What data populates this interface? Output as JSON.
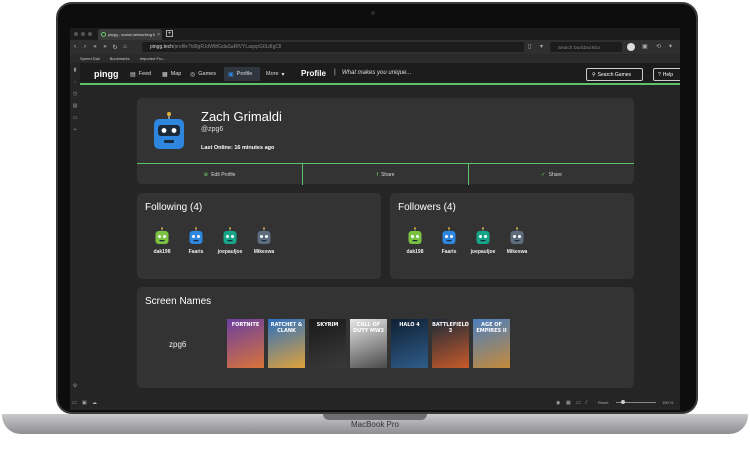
{
  "device": {
    "label": "MacBook Pro"
  },
  "browser": {
    "tab_title": "pingg - social networking fo",
    "tab_close": "×",
    "new_tab": "+",
    "url_host": "pingg.tech",
    "url_path": "/profile?id9gRJdWMGdaSaRfVYLaqxpG0LdIgCll",
    "search_placeholder": "Search DuckDuckGo",
    "bookmarks": [
      "Speed Dial",
      "Bookmarks",
      "Imported Fro..."
    ],
    "status_reset": "Reset",
    "zoom": "100 %"
  },
  "site": {
    "logo": "pingg",
    "nav": [
      {
        "label": "Feed",
        "icon": "feed-icon"
      },
      {
        "label": "Map",
        "icon": "map-icon"
      },
      {
        "label": "Games",
        "icon": "gamepad-icon"
      },
      {
        "label": "Profile",
        "icon": "robot-icon",
        "active": true
      },
      {
        "label": "More",
        "icon": "chevron-down-icon"
      }
    ],
    "page_title": "Profile",
    "separator": "|",
    "tagline": "What makes you unique...",
    "search_games": "Search Games",
    "help": "Help"
  },
  "profile": {
    "name": "Zach Grimaldi",
    "handle": "@zpg6",
    "last_online_label": "Last Online:",
    "last_online_value": "16 minutes ago",
    "actions": [
      "Edit Profile",
      "Share",
      "Share"
    ]
  },
  "following": {
    "title": "Following (4)",
    "users": [
      {
        "name": "dak198",
        "color": "#7ac143"
      },
      {
        "name": "Faaris",
        "color": "#2e86de"
      },
      {
        "name": "joepauljoe",
        "color": "#17a589"
      },
      {
        "name": "Mikeswa",
        "color": "#5d6d7e"
      }
    ]
  },
  "followers": {
    "title": "Followers (4)",
    "users": [
      {
        "name": "dak198",
        "color": "#7ac143"
      },
      {
        "name": "Faaris",
        "color": "#2e86de"
      },
      {
        "name": "joepauljoe",
        "color": "#17a589"
      },
      {
        "name": "Mikeswa",
        "color": "#5d6d7e"
      }
    ]
  },
  "screen_names": {
    "title": "Screen Names",
    "name": "zpg6",
    "games": [
      {
        "title": "FORTNITE",
        "colors": [
          "#6a3fa0",
          "#d9733a"
        ]
      },
      {
        "title": "RATCHET & CLANK",
        "colors": [
          "#2a6fc2",
          "#e0a23a"
        ]
      },
      {
        "title": "SKYRIM",
        "colors": [
          "#1a1a1a",
          "#3a3a3a"
        ]
      },
      {
        "title": "CALL OF DUTY MW3",
        "colors": [
          "#e8e8e8",
          "#4a4a4a"
        ]
      },
      {
        "title": "HALO 4",
        "colors": [
          "#0f1f33",
          "#2f5d8a"
        ]
      },
      {
        "title": "BATTLEFIELD 3",
        "colors": [
          "#1c2a38",
          "#c85a2a"
        ]
      },
      {
        "title": "AGE OF EMPIRES II",
        "colors": [
          "#4a7fc0",
          "#c58a3a"
        ]
      }
    ]
  }
}
